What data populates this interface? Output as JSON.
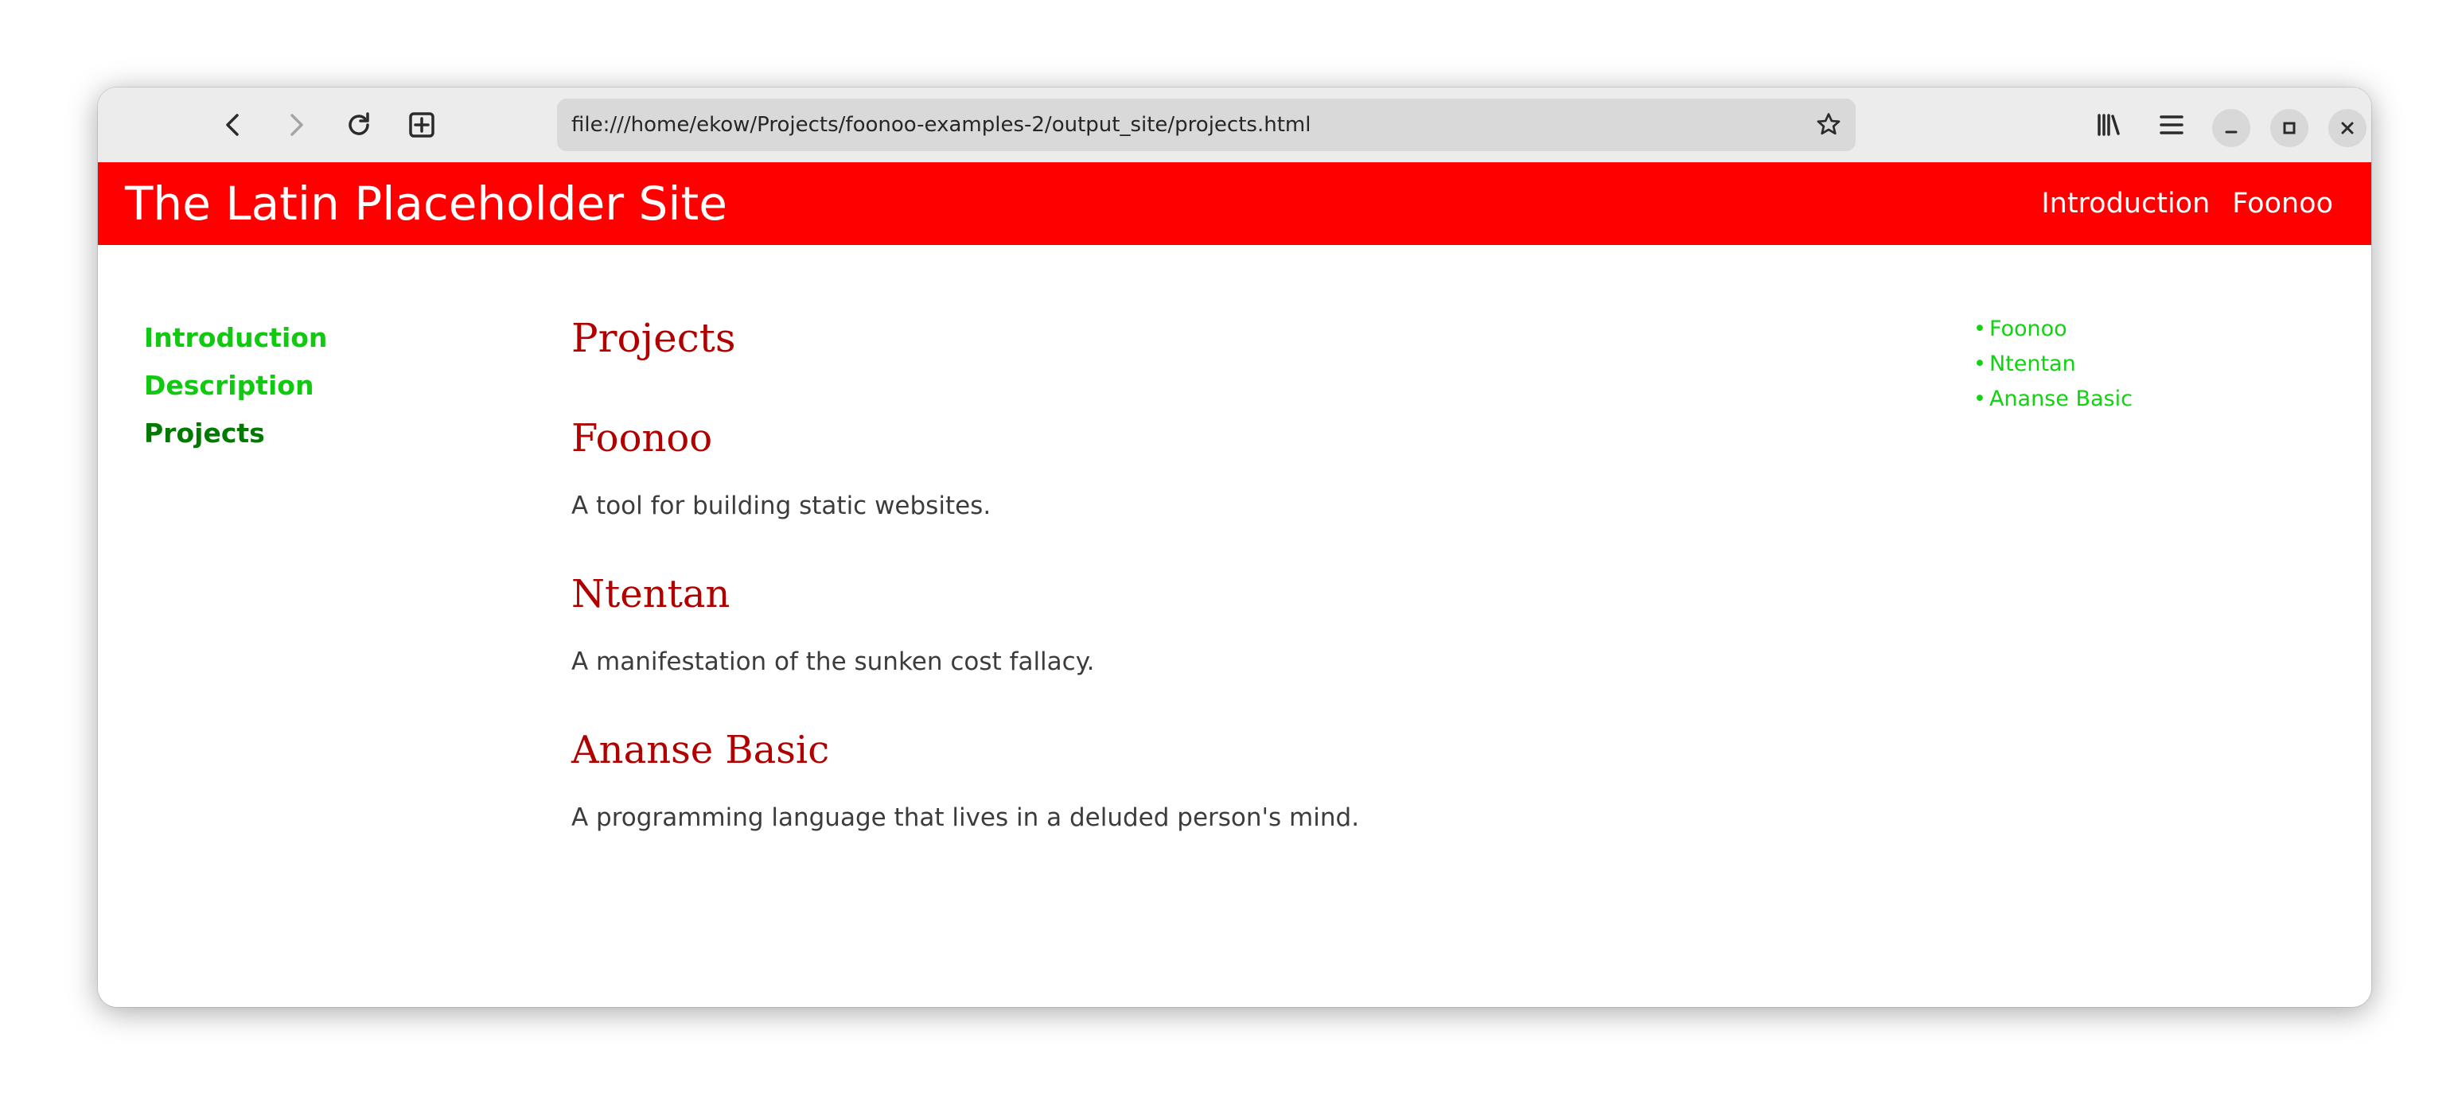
{
  "browser": {
    "url": "file:///home/ekow/Projects/foonoo-examples-2/output_site/projects.html"
  },
  "site": {
    "title": "The Latin Placeholder Site",
    "top_nav": [
      "Introduction",
      "Foonoo"
    ],
    "header_color": "#ff0000"
  },
  "side_nav": {
    "items": [
      "Introduction",
      "Description",
      "Projects"
    ],
    "current": "Projects"
  },
  "content": {
    "heading": "Projects",
    "sections": [
      {
        "title": "Foonoo",
        "text": "A tool for building static websites."
      },
      {
        "title": "Ntentan",
        "text": "A manifestation of the sunken cost fallacy."
      },
      {
        "title": "Ananse Basic",
        "text": "A programming language that lives in a deluded person's mind."
      }
    ]
  },
  "toc": {
    "bullet": "•",
    "items": [
      "Foonoo",
      "Ntentan",
      "Ananse Basic"
    ]
  },
  "icons": {
    "back": "back-arrow-icon",
    "forward": "forward-arrow-icon",
    "reload": "reload-icon",
    "new_tab": "new-tab-icon",
    "bookmark": "star-icon",
    "library": "library-icon",
    "menu": "hamburger-menu-icon",
    "minimize": "minimize-icon",
    "maximize": "maximize-icon",
    "close": "close-icon"
  }
}
